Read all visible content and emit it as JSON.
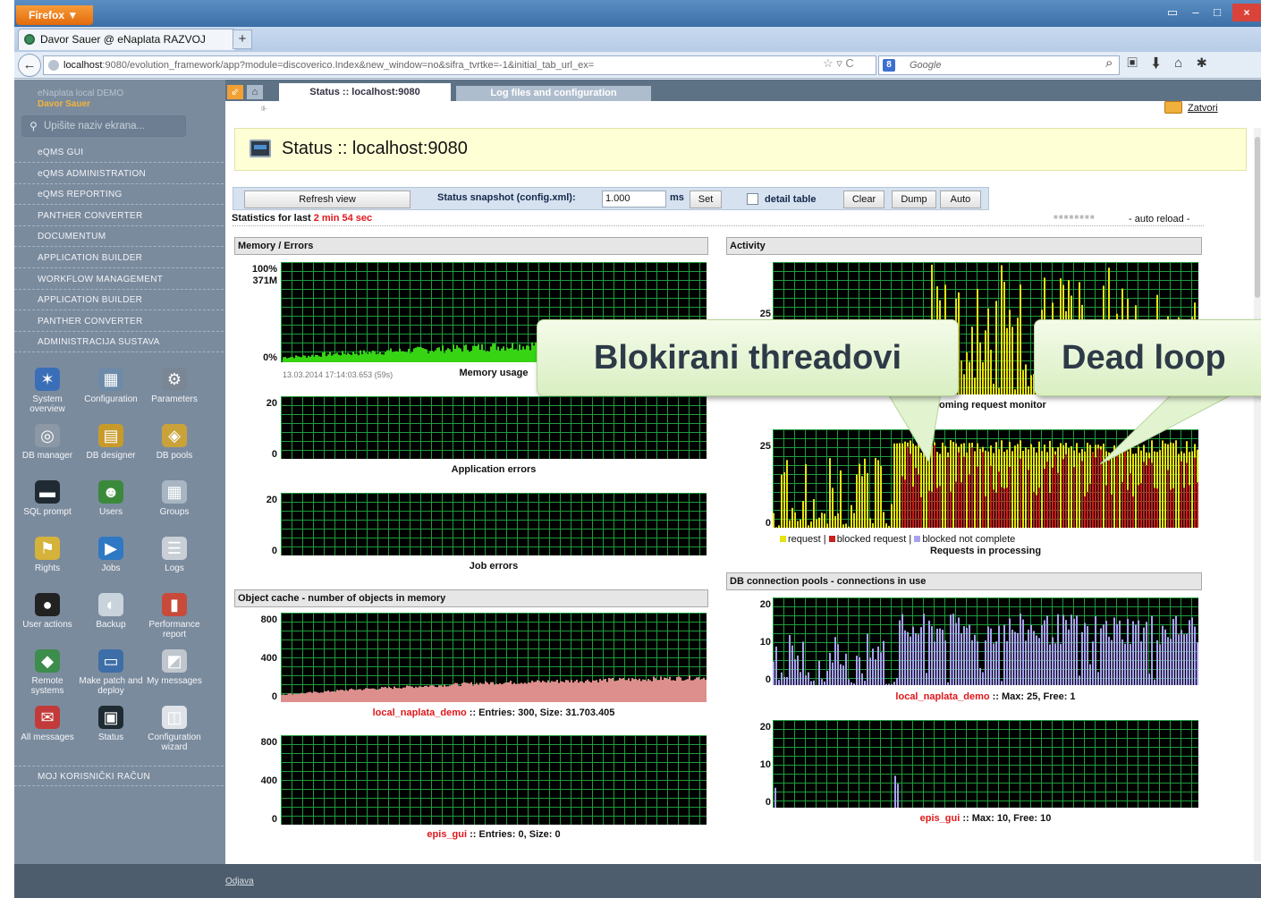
{
  "browser": {
    "firefox_label": "Firefox ▼",
    "tab_title": "Davor Sauer @ eNaplata RAZVOJ",
    "new_tab": "+",
    "url_host": "localhost",
    "url_rest": ":9080/evolution_framework/app?module=discoverico.Index&new_window=no&sifra_tvrtke=-1&initial_tab_url_ex=",
    "search_placeholder": "Google",
    "window_controls": {
      "minimize": "–",
      "maximize": "□",
      "close": "×"
    }
  },
  "sidebar": {
    "app_name": "eNaplata local DEMO",
    "user_name": "Davor Sauer",
    "search_placeholder": "Upišite naziv ekrana...",
    "menu": [
      {
        "label": "eQMS GUI"
      },
      {
        "label": "eQMS ADMINISTRATION"
      },
      {
        "label": "eQMS REPORTING"
      },
      {
        "label": "PANTHER CONVERTER"
      },
      {
        "label": "DOCUMENTUM"
      },
      {
        "label": "APPLICATION BUILDER"
      },
      {
        "label": "WORKFLOW MANAGEMENT"
      },
      {
        "label": "APPLICATION BUILDER"
      },
      {
        "label": "PANTHER CONVERTER"
      },
      {
        "label": "ADMINISTRACIJA SUSTAVA"
      }
    ],
    "icons": [
      {
        "label": "System overview",
        "icon": "system-overview-icon",
        "color": "#3a6fb8"
      },
      {
        "label": "Configuration",
        "icon": "configuration-icon",
        "color": "#6d8aa8"
      },
      {
        "label": "Parameters",
        "icon": "parameters-icon",
        "color": "#7a8693"
      },
      {
        "label": "DB manager",
        "icon": "db-manager-icon",
        "color": "#8c98a5"
      },
      {
        "label": "DB designer",
        "icon": "db-designer-icon",
        "color": "#c89a2a"
      },
      {
        "label": "DB pools",
        "icon": "db-pools-icon",
        "color": "#caa23a"
      },
      {
        "label": "SQL prompt",
        "icon": "sql-prompt-icon",
        "color": "#1f2a33"
      },
      {
        "label": "Users",
        "icon": "users-icon",
        "color": "#3b8a3b"
      },
      {
        "label": "Groups",
        "icon": "groups-icon",
        "color": "#a8b5c2"
      },
      {
        "label": "Rights",
        "icon": "rights-icon",
        "color": "#d5b23a"
      },
      {
        "label": "Jobs",
        "icon": "jobs-icon",
        "color": "#2f78c4"
      },
      {
        "label": "Logs",
        "icon": "logs-icon",
        "color": "#c9cfd6"
      },
      {
        "label": "User actions",
        "icon": "user-actions-icon",
        "color": "#222222"
      },
      {
        "label": "Backup",
        "icon": "backup-icon",
        "color": "#c9d3dc"
      },
      {
        "label": "Performance report",
        "icon": "performance-report-icon",
        "color": "#c84a3a"
      },
      {
        "label": "Remote systems",
        "icon": "remote-systems-icon",
        "color": "#3d8d4d"
      },
      {
        "label": "Make patch and deploy",
        "icon": "make-patch-icon",
        "color": "#3d6ea8"
      },
      {
        "label": "My messages",
        "icon": "my-messages-icon",
        "color": "#c0c6cd"
      },
      {
        "label": "All messages",
        "icon": "all-messages-icon",
        "color": "#c23a3a"
      },
      {
        "label": "Status",
        "icon": "status-icon",
        "color": "#1f2a33"
      },
      {
        "label": "Configuration wizard",
        "icon": "configuration-wizard-icon",
        "color": "#dfe3e8"
      }
    ],
    "bottom_menu": "MOJ KORISNIČKI RAČUN"
  },
  "content": {
    "tab_active": "Status :: localhost:9080",
    "tab_other": "Log files and configuration",
    "close_label": "Zatvori",
    "header_title": "Status :: localhost:9080",
    "toolbar": {
      "refresh": "Refresh view",
      "snapshot_label": "Status snapshot (config.xml):",
      "snapshot_value": "1.000",
      "ms": "ms",
      "set": "Set",
      "detail_table": "detail table",
      "clear": "Clear",
      "dump": "Dump",
      "auto": "Auto"
    },
    "stats_prefix": "Statistics for last ",
    "stats_time": "2 min 54 sec",
    "auto_reload": "- auto reload -"
  },
  "panels": {
    "memory_errors": "Memory / Errors",
    "activity": "Activity",
    "object_cache": "Object cache - number of objects in memory",
    "db_pools": "DB connection pools - connections in use"
  },
  "charts": {
    "memory": {
      "y_top": "100%",
      "y_top2": "371M",
      "y_bottom": "0%",
      "timestamp": "13.03.2014 17:14:03.653 (59s)",
      "title": "Memory usage"
    },
    "app_errors": {
      "y_top": "20",
      "y_bottom": "0",
      "title": "Application errors"
    },
    "job_errors": {
      "y_top": "20",
      "y_bottom": "0",
      "title": "Job errors"
    },
    "cache1": {
      "y_top": "800",
      "y_mid": "400",
      "y_bottom": "0",
      "name": "local_naplata_demo",
      "info": " :: Entries: 300, Size: 31.703.405"
    },
    "cache2": {
      "y_top": "800",
      "y_mid": "400",
      "y_bottom": "0",
      "name": "epis_gui",
      "info": " :: Entries: 0, Size: 0"
    },
    "incoming": {
      "y_mid": "25",
      "title": "Incoming request monitor"
    },
    "processing": {
      "y_top": "25",
      "y_bottom": "0",
      "title": "Requests in processing",
      "legend": {
        "request": "request",
        "sep1": " | ",
        "blocked": "blocked request",
        "sep2": " | ",
        "not_complete": "blocked not complete"
      }
    },
    "pool1": {
      "y_top": "20",
      "y_mid": "10",
      "y_bottom": "0",
      "name": "local_naplata_demo",
      "info": " :: Max: 25, Free: 1"
    },
    "pool2": {
      "y_top": "20",
      "y_mid": "10",
      "y_bottom": "0",
      "name": "epis_gui",
      "info": " :: Max: 10, Free: 10"
    }
  },
  "callouts": {
    "blocked": "Blokirani threadovi",
    "deadloop": "Dead loop"
  },
  "footer": {
    "logout": "Odjava"
  },
  "colors": {
    "grid": "#1f9c3b",
    "memory": "#37d414",
    "request": "#e7e30e",
    "blocked": "#c9201d",
    "cache": "#dc8f8d",
    "pool": "#a8a3ef",
    "warning_text": "#e0171b"
  },
  "chart_data": [
    {
      "type": "area",
      "title": "Memory usage",
      "ylim": [
        0,
        100
      ],
      "y_unit": "%",
      "trend": [
        5,
        6,
        8,
        9,
        10,
        11,
        12,
        13,
        14,
        15,
        16,
        17,
        18,
        19,
        20,
        21,
        22,
        24,
        26,
        28
      ],
      "color": "#37d414"
    },
    {
      "type": "bar",
      "title": "Application errors",
      "ylim": [
        0,
        20
      ],
      "values": []
    },
    {
      "type": "bar",
      "title": "Job errors",
      "ylim": [
        0,
        20
      ],
      "values": []
    },
    {
      "type": "bar",
      "title": "Incoming request monitor",
      "ylim": [
        0,
        35
      ],
      "series": [
        {
          "name": "request",
          "color": "#e7e30e"
        }
      ]
    },
    {
      "type": "bar",
      "title": "Requests in processing",
      "ylim": [
        0,
        28
      ],
      "series": [
        {
          "name": "request",
          "color": "#e7e30e"
        },
        {
          "name": "blocked request",
          "color": "#c9201d"
        },
        {
          "name": "blocked not complete",
          "color": "#a8a3ef"
        }
      ]
    },
    {
      "type": "bar",
      "title": "local_naplata_demo",
      "ylim": [
        0,
        800
      ],
      "trend": [
        70,
        80,
        95,
        110,
        120,
        130,
        140,
        150,
        160,
        170,
        175,
        180,
        185,
        190,
        195,
        200,
        205,
        210,
        215,
        220
      ],
      "color": "#dc8f8d"
    },
    {
      "type": "bar",
      "title": "epis_gui",
      "ylim": [
        0,
        800
      ],
      "values": []
    },
    {
      "type": "bar",
      "title": "local_naplata_demo pool",
      "ylim": [
        0,
        22
      ],
      "max": 25,
      "free": 1,
      "color": "#a8a3ef"
    },
    {
      "type": "bar",
      "title": "epis_gui pool",
      "ylim": [
        0,
        22
      ],
      "max": 10,
      "free": 10,
      "color": "#a8a3ef"
    }
  ]
}
